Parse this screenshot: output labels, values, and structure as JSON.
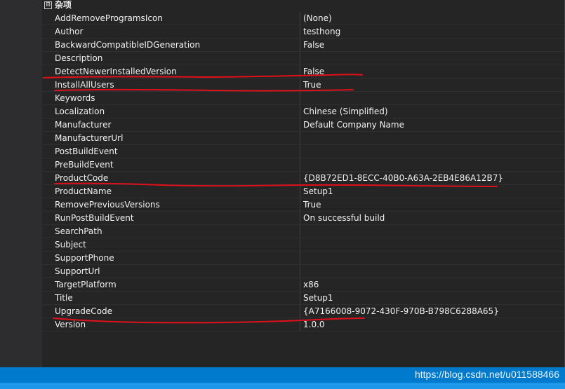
{
  "category": {
    "toggle": "⊟",
    "label": "杂项"
  },
  "properties": [
    {
      "name": "AddRemoveProgramsIcon",
      "value": "(None)"
    },
    {
      "name": "Author",
      "value": "testhong"
    },
    {
      "name": "BackwardCompatibleIDGeneration",
      "value": "False"
    },
    {
      "name": "Description",
      "value": ""
    },
    {
      "name": "DetectNewerInstalledVersion",
      "value": "False"
    },
    {
      "name": "InstallAllUsers",
      "value": "True"
    },
    {
      "name": "Keywords",
      "value": ""
    },
    {
      "name": "Localization",
      "value": "Chinese (Simplified)"
    },
    {
      "name": "Manufacturer",
      "value": "Default Company Name"
    },
    {
      "name": "ManufacturerUrl",
      "value": ""
    },
    {
      "name": "PostBuildEvent",
      "value": ""
    },
    {
      "name": "PreBuildEvent",
      "value": ""
    },
    {
      "name": "ProductCode",
      "value": "{D8B72ED1-8ECC-40B0-A63A-2EB4E86A12B7}"
    },
    {
      "name": "ProductName",
      "value": "Setup1"
    },
    {
      "name": "RemovePreviousVersions",
      "value": "True"
    },
    {
      "name": "RunPostBuildEvent",
      "value": "On successful build"
    },
    {
      "name": "SearchPath",
      "value": ""
    },
    {
      "name": "Subject",
      "value": ""
    },
    {
      "name": "SupportPhone",
      "value": ""
    },
    {
      "name": "SupportUrl",
      "value": ""
    },
    {
      "name": "TargetPlatform",
      "value": "x86"
    },
    {
      "name": "Title",
      "value": "Setup1"
    },
    {
      "name": "UpgradeCode",
      "value": "{A7166008-9072-430F-970B-B798C6288A65}"
    },
    {
      "name": "Version",
      "value": "1.0.0"
    }
  ],
  "statusbar": {
    "watermark": "https://blog.csdn.net/u011588466",
    "icons": "◂ ✕"
  },
  "colors": {
    "background": "#252526",
    "text": "#f1f1f1",
    "statusbar": "#007acc",
    "annotation": "#e0101a"
  }
}
